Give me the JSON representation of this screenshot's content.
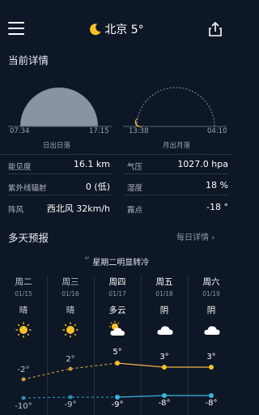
{
  "header": {
    "city": "北京",
    "temp": "5°"
  },
  "details": {
    "section_title": "当前详情",
    "sun": {
      "rise": "07:34",
      "set": "17:15",
      "label": "日出日落"
    },
    "moon": {
      "rise": "13:38",
      "set": "04:10",
      "label": "月出月落"
    },
    "rows": [
      {
        "label_l": "能见度",
        "value_l": "16.1 km",
        "label_r": "气压",
        "value_r": "1027.0 hpa"
      },
      {
        "label_l": "紫外线辐射",
        "value_l": "0 (低)",
        "label_r": "湿度",
        "value_r": "18 %"
      },
      {
        "label_l": "阵风",
        "value_l": "西北风 32km/h",
        "label_r": "露点",
        "value_r": "-18 °"
      }
    ]
  },
  "forecast": {
    "section_title": "多天预报",
    "mode_link": "每日详情",
    "quote": "星期二明显转冷",
    "days": [
      {
        "day": "周二",
        "date": "01/15",
        "weather": "晴",
        "icon": "sun-icon",
        "high": "-2°",
        "low": "-10°"
      },
      {
        "day": "周三",
        "date": "01/16",
        "weather": "晴",
        "icon": "sun-icon",
        "high": "2°",
        "low": "-9°"
      },
      {
        "day": "周四",
        "date": "01/17",
        "weather": "多云",
        "icon": "partly-cloudy-icon",
        "high": "5°",
        "low": "-9°"
      },
      {
        "day": "周五",
        "date": "01/18",
        "weather": "阴",
        "icon": "cloud-icon",
        "high": "3°",
        "low": "-8°"
      },
      {
        "day": "周六",
        "date": "01/19",
        "weather": "阴",
        "icon": "cloud-icon",
        "high": "3°",
        "low": "-8°"
      }
    ]
  },
  "colors": {
    "accent_sun": "#f6c229",
    "high_line": "#f1b443",
    "low_line": "#35b6e0",
    "bg": "#0e1726"
  }
}
